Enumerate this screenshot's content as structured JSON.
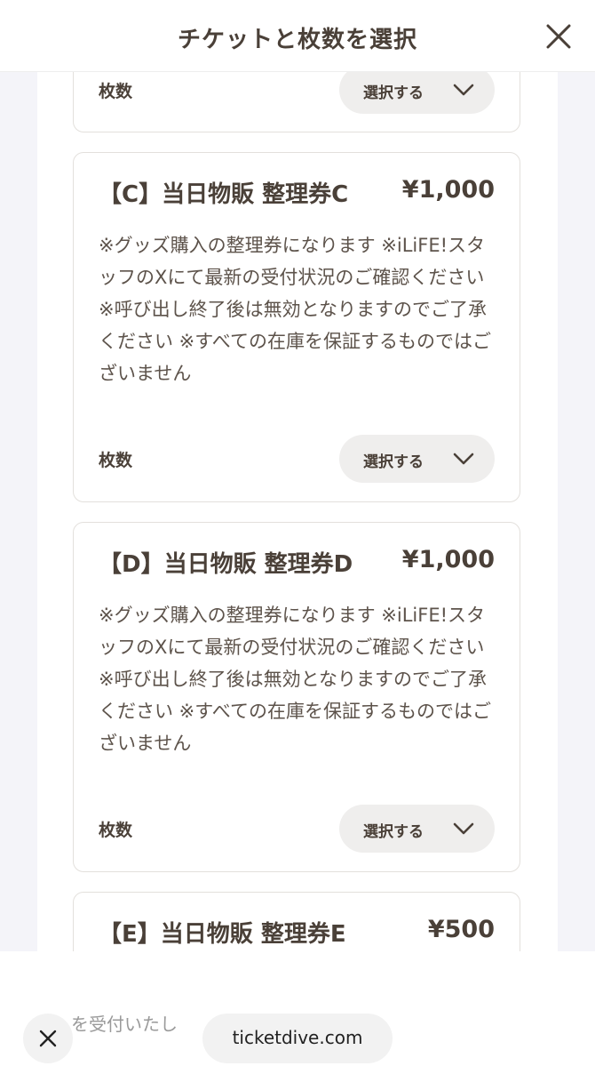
{
  "header": {
    "title": "チケットと枚数を選択"
  },
  "tickets": [
    {
      "qty_label": "枚数",
      "select_label": "選択する"
    },
    {
      "name": "【C】当日物販 整理券C",
      "price": "¥1,000",
      "description": "※グッズ購入の整理券になります ※iLiFE!スタッフのXにて最新の受付状況のご確認ください ※呼び出し終了後は無効となりますのでご了承ください ※すべての在庫を保証するものではございません",
      "qty_label": "枚数",
      "select_label": "選択する"
    },
    {
      "name": "【D】当日物販 整理券D",
      "price": "¥1,000",
      "description": "※グッズ購入の整理券になります ※iLiFE!スタッフのXにて最新の受付状況のご確認ください ※呼び出し終了後は無効となりますのでご了承ください ※すべての在庫を保証するものではございません",
      "qty_label": "枚数",
      "select_label": "選択する"
    },
    {
      "name": "【E】当日物販 整理券E",
      "price": "¥500"
    }
  ],
  "browser": {
    "hint_text": "を受付いたし",
    "url": "ticketdive.com"
  },
  "colors": {
    "text": "#4a4038",
    "card_border": "#e3e0dc",
    "select_bg": "#efeeed",
    "backdrop": "#f4f4f9"
  }
}
